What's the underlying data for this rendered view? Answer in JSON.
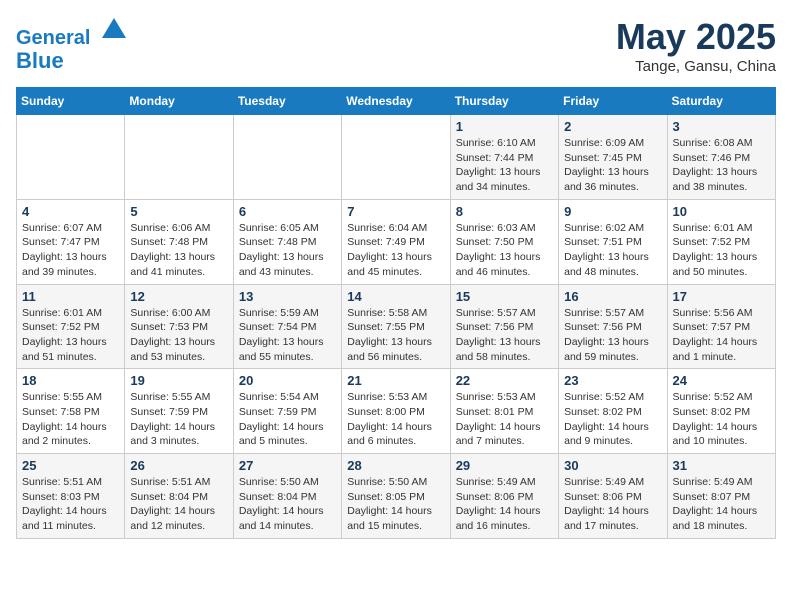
{
  "header": {
    "logo_line1": "General",
    "logo_line2": "Blue",
    "month": "May 2025",
    "location": "Tange, Gansu, China"
  },
  "weekdays": [
    "Sunday",
    "Monday",
    "Tuesday",
    "Wednesday",
    "Thursday",
    "Friday",
    "Saturday"
  ],
  "weeks": [
    [
      {
        "day": "",
        "info": ""
      },
      {
        "day": "",
        "info": ""
      },
      {
        "day": "",
        "info": ""
      },
      {
        "day": "",
        "info": ""
      },
      {
        "day": "1",
        "info": "Sunrise: 6:10 AM\nSunset: 7:44 PM\nDaylight: 13 hours\nand 34 minutes."
      },
      {
        "day": "2",
        "info": "Sunrise: 6:09 AM\nSunset: 7:45 PM\nDaylight: 13 hours\nand 36 minutes."
      },
      {
        "day": "3",
        "info": "Sunrise: 6:08 AM\nSunset: 7:46 PM\nDaylight: 13 hours\nand 38 minutes."
      }
    ],
    [
      {
        "day": "4",
        "info": "Sunrise: 6:07 AM\nSunset: 7:47 PM\nDaylight: 13 hours\nand 39 minutes."
      },
      {
        "day": "5",
        "info": "Sunrise: 6:06 AM\nSunset: 7:48 PM\nDaylight: 13 hours\nand 41 minutes."
      },
      {
        "day": "6",
        "info": "Sunrise: 6:05 AM\nSunset: 7:48 PM\nDaylight: 13 hours\nand 43 minutes."
      },
      {
        "day": "7",
        "info": "Sunrise: 6:04 AM\nSunset: 7:49 PM\nDaylight: 13 hours\nand 45 minutes."
      },
      {
        "day": "8",
        "info": "Sunrise: 6:03 AM\nSunset: 7:50 PM\nDaylight: 13 hours\nand 46 minutes."
      },
      {
        "day": "9",
        "info": "Sunrise: 6:02 AM\nSunset: 7:51 PM\nDaylight: 13 hours\nand 48 minutes."
      },
      {
        "day": "10",
        "info": "Sunrise: 6:01 AM\nSunset: 7:52 PM\nDaylight: 13 hours\nand 50 minutes."
      }
    ],
    [
      {
        "day": "11",
        "info": "Sunrise: 6:01 AM\nSunset: 7:52 PM\nDaylight: 13 hours\nand 51 minutes."
      },
      {
        "day": "12",
        "info": "Sunrise: 6:00 AM\nSunset: 7:53 PM\nDaylight: 13 hours\nand 53 minutes."
      },
      {
        "day": "13",
        "info": "Sunrise: 5:59 AM\nSunset: 7:54 PM\nDaylight: 13 hours\nand 55 minutes."
      },
      {
        "day": "14",
        "info": "Sunrise: 5:58 AM\nSunset: 7:55 PM\nDaylight: 13 hours\nand 56 minutes."
      },
      {
        "day": "15",
        "info": "Sunrise: 5:57 AM\nSunset: 7:56 PM\nDaylight: 13 hours\nand 58 minutes."
      },
      {
        "day": "16",
        "info": "Sunrise: 5:57 AM\nSunset: 7:56 PM\nDaylight: 13 hours\nand 59 minutes."
      },
      {
        "day": "17",
        "info": "Sunrise: 5:56 AM\nSunset: 7:57 PM\nDaylight: 14 hours\nand 1 minute."
      }
    ],
    [
      {
        "day": "18",
        "info": "Sunrise: 5:55 AM\nSunset: 7:58 PM\nDaylight: 14 hours\nand 2 minutes."
      },
      {
        "day": "19",
        "info": "Sunrise: 5:55 AM\nSunset: 7:59 PM\nDaylight: 14 hours\nand 3 minutes."
      },
      {
        "day": "20",
        "info": "Sunrise: 5:54 AM\nSunset: 7:59 PM\nDaylight: 14 hours\nand 5 minutes."
      },
      {
        "day": "21",
        "info": "Sunrise: 5:53 AM\nSunset: 8:00 PM\nDaylight: 14 hours\nand 6 minutes."
      },
      {
        "day": "22",
        "info": "Sunrise: 5:53 AM\nSunset: 8:01 PM\nDaylight: 14 hours\nand 7 minutes."
      },
      {
        "day": "23",
        "info": "Sunrise: 5:52 AM\nSunset: 8:02 PM\nDaylight: 14 hours\nand 9 minutes."
      },
      {
        "day": "24",
        "info": "Sunrise: 5:52 AM\nSunset: 8:02 PM\nDaylight: 14 hours\nand 10 minutes."
      }
    ],
    [
      {
        "day": "25",
        "info": "Sunrise: 5:51 AM\nSunset: 8:03 PM\nDaylight: 14 hours\nand 11 minutes."
      },
      {
        "day": "26",
        "info": "Sunrise: 5:51 AM\nSunset: 8:04 PM\nDaylight: 14 hours\nand 12 minutes."
      },
      {
        "day": "27",
        "info": "Sunrise: 5:50 AM\nSunset: 8:04 PM\nDaylight: 14 hours\nand 14 minutes."
      },
      {
        "day": "28",
        "info": "Sunrise: 5:50 AM\nSunset: 8:05 PM\nDaylight: 14 hours\nand 15 minutes."
      },
      {
        "day": "29",
        "info": "Sunrise: 5:49 AM\nSunset: 8:06 PM\nDaylight: 14 hours\nand 16 minutes."
      },
      {
        "day": "30",
        "info": "Sunrise: 5:49 AM\nSunset: 8:06 PM\nDaylight: 14 hours\nand 17 minutes."
      },
      {
        "day": "31",
        "info": "Sunrise: 5:49 AM\nSunset: 8:07 PM\nDaylight: 14 hours\nand 18 minutes."
      }
    ]
  ]
}
